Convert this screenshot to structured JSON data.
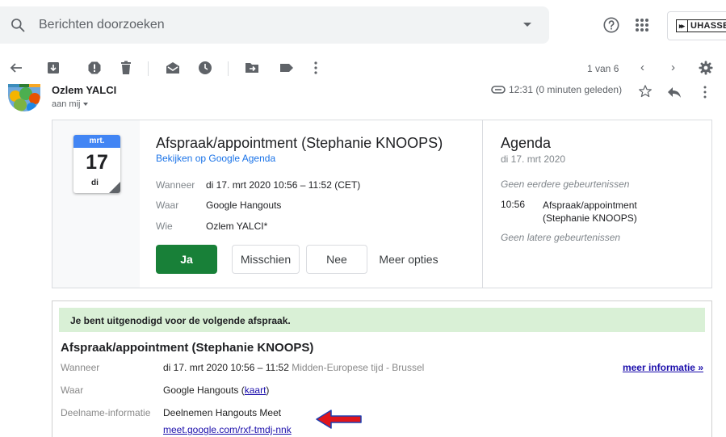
{
  "search": {
    "placeholder": "Berichten doorzoeken"
  },
  "brand": {
    "arrows": "▸▸",
    "name": "UHASSELT"
  },
  "toolbar": {
    "pager": "1 van 6",
    "prev": "‹",
    "next": "›"
  },
  "message": {
    "sender": "Ozlem YALCI",
    "to": "aan mij",
    "time": "12:31 (0 minuten geleden)"
  },
  "invite": {
    "cal_month": "mrt.",
    "cal_day": "17",
    "cal_weekday": "di",
    "title": "Afspraak/appointment (Stephanie KNOOPS)",
    "view_link": "Bekijken op Google Agenda",
    "when_label": "Wanneer",
    "when_value": "di 17. mrt 2020 10:56 – 11:52 (CET)",
    "where_label": "Waar",
    "where_value": "Google Hangouts",
    "who_label": "Wie",
    "who_value": "Ozlem YALCI*",
    "btn_yes": "Ja",
    "btn_maybe": "Misschien",
    "btn_no": "Nee",
    "btn_more": "Meer opties"
  },
  "agenda": {
    "title": "Agenda",
    "date": "di 17. mrt 2020",
    "no_earlier": "Geen eerdere gebeurtenissen",
    "event_time": "10:56",
    "event_title": "Afspraak/appointment (Stephanie KNOOPS)",
    "no_later": "Geen latere gebeurtenissen"
  },
  "plain": {
    "banner": "Je bent uitgenodigd voor de volgende afspraak.",
    "title": "Afspraak/appointment (Stephanie KNOOPS)",
    "when_label": "Wanneer",
    "when_value": "di 17. mrt 2020 10:56 – 11:52",
    "when_tz": "Midden-Europese tijd - Brussel",
    "more_info": "meer informatie »",
    "where_label": "Waar",
    "where_value": "Google Hangouts (",
    "where_link": "kaart",
    "where_close": ")",
    "join_label": "Deelname-informatie",
    "join_value": "Deelnemen Hangouts Meet",
    "join_link": "meet.google.com/rxf-tmdj-nnk"
  },
  "colors": {
    "accept": "#188038",
    "link": "#1a73e8",
    "banner": "#d9f0d6",
    "arrow": "#e0151b"
  }
}
